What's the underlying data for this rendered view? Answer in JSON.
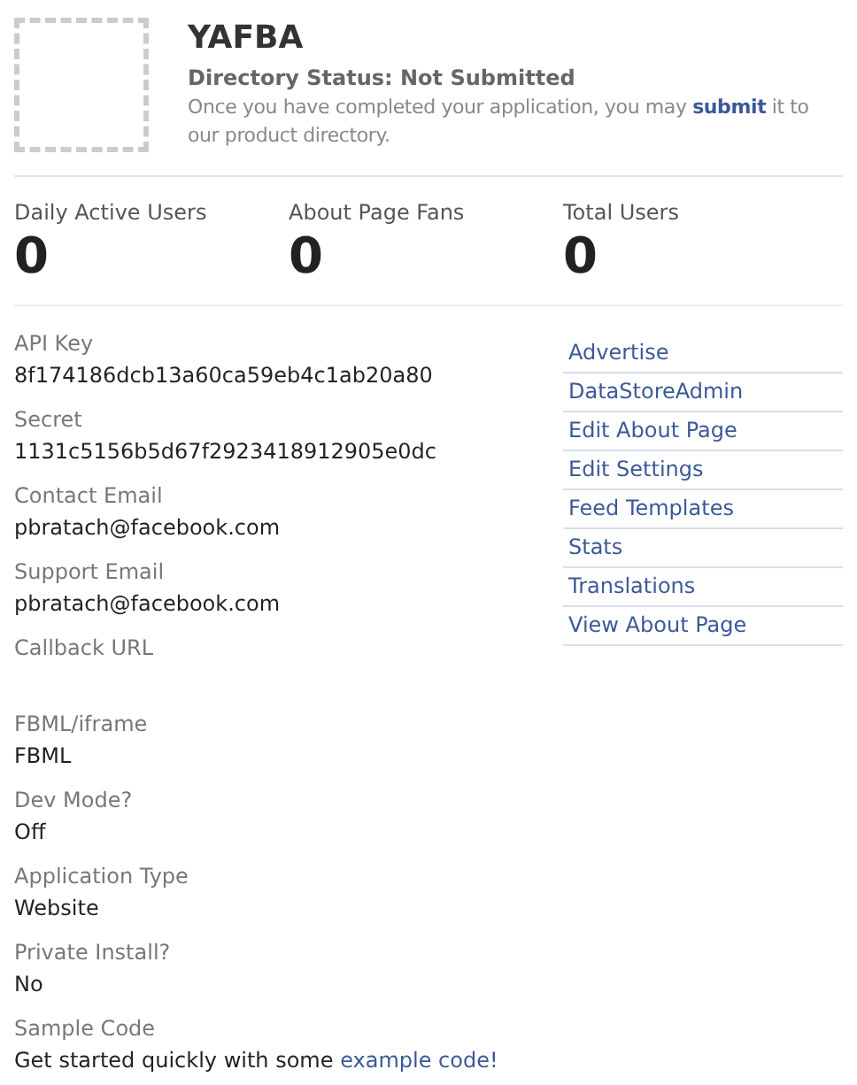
{
  "app": {
    "name": "YAFBA",
    "status": "Directory Status: Not Submitted",
    "note": "Once you have completed your application, you may",
    "note_link": "submit",
    "note_end": "it to our product directory."
  },
  "stats": [
    {
      "label": "Daily Active Users",
      "value": "0"
    },
    {
      "label": "About Page Fans",
      "value": "0"
    },
    {
      "label": "Total Users",
      "value": "0"
    }
  ],
  "details": [
    {
      "label": "API Key",
      "value": "8f174186dcb13a60ca59eb4c1ab20a80"
    },
    {
      "label": "Secret",
      "value": "1131c5156b5d67f2923418912905e0dc"
    },
    {
      "label": "Contact Email",
      "value": "pbratach@facebook.com"
    },
    {
      "label": "Support Email",
      "value": "pbratach@facebook.com"
    },
    {
      "label": "Callback URL"
    },
    {
      "label": "FBML/iframe",
      "value": "FBML"
    },
    {
      "label": "Dev Mode?",
      "value": "Off"
    },
    {
      "label": "Application Type",
      "value": "Website"
    },
    {
      "label": "Private Install?",
      "value": "No"
    },
    {
      "label": "Sample Code",
      "value": "Get started quickly with some",
      "link": "example code!"
    }
  ],
  "links": [
    "Advertise",
    "DataStoreAdmin",
    "Edit About Page",
    "Edit Settings",
    "Feed Templates",
    "Stats",
    "Translations",
    "View About Page"
  ]
}
